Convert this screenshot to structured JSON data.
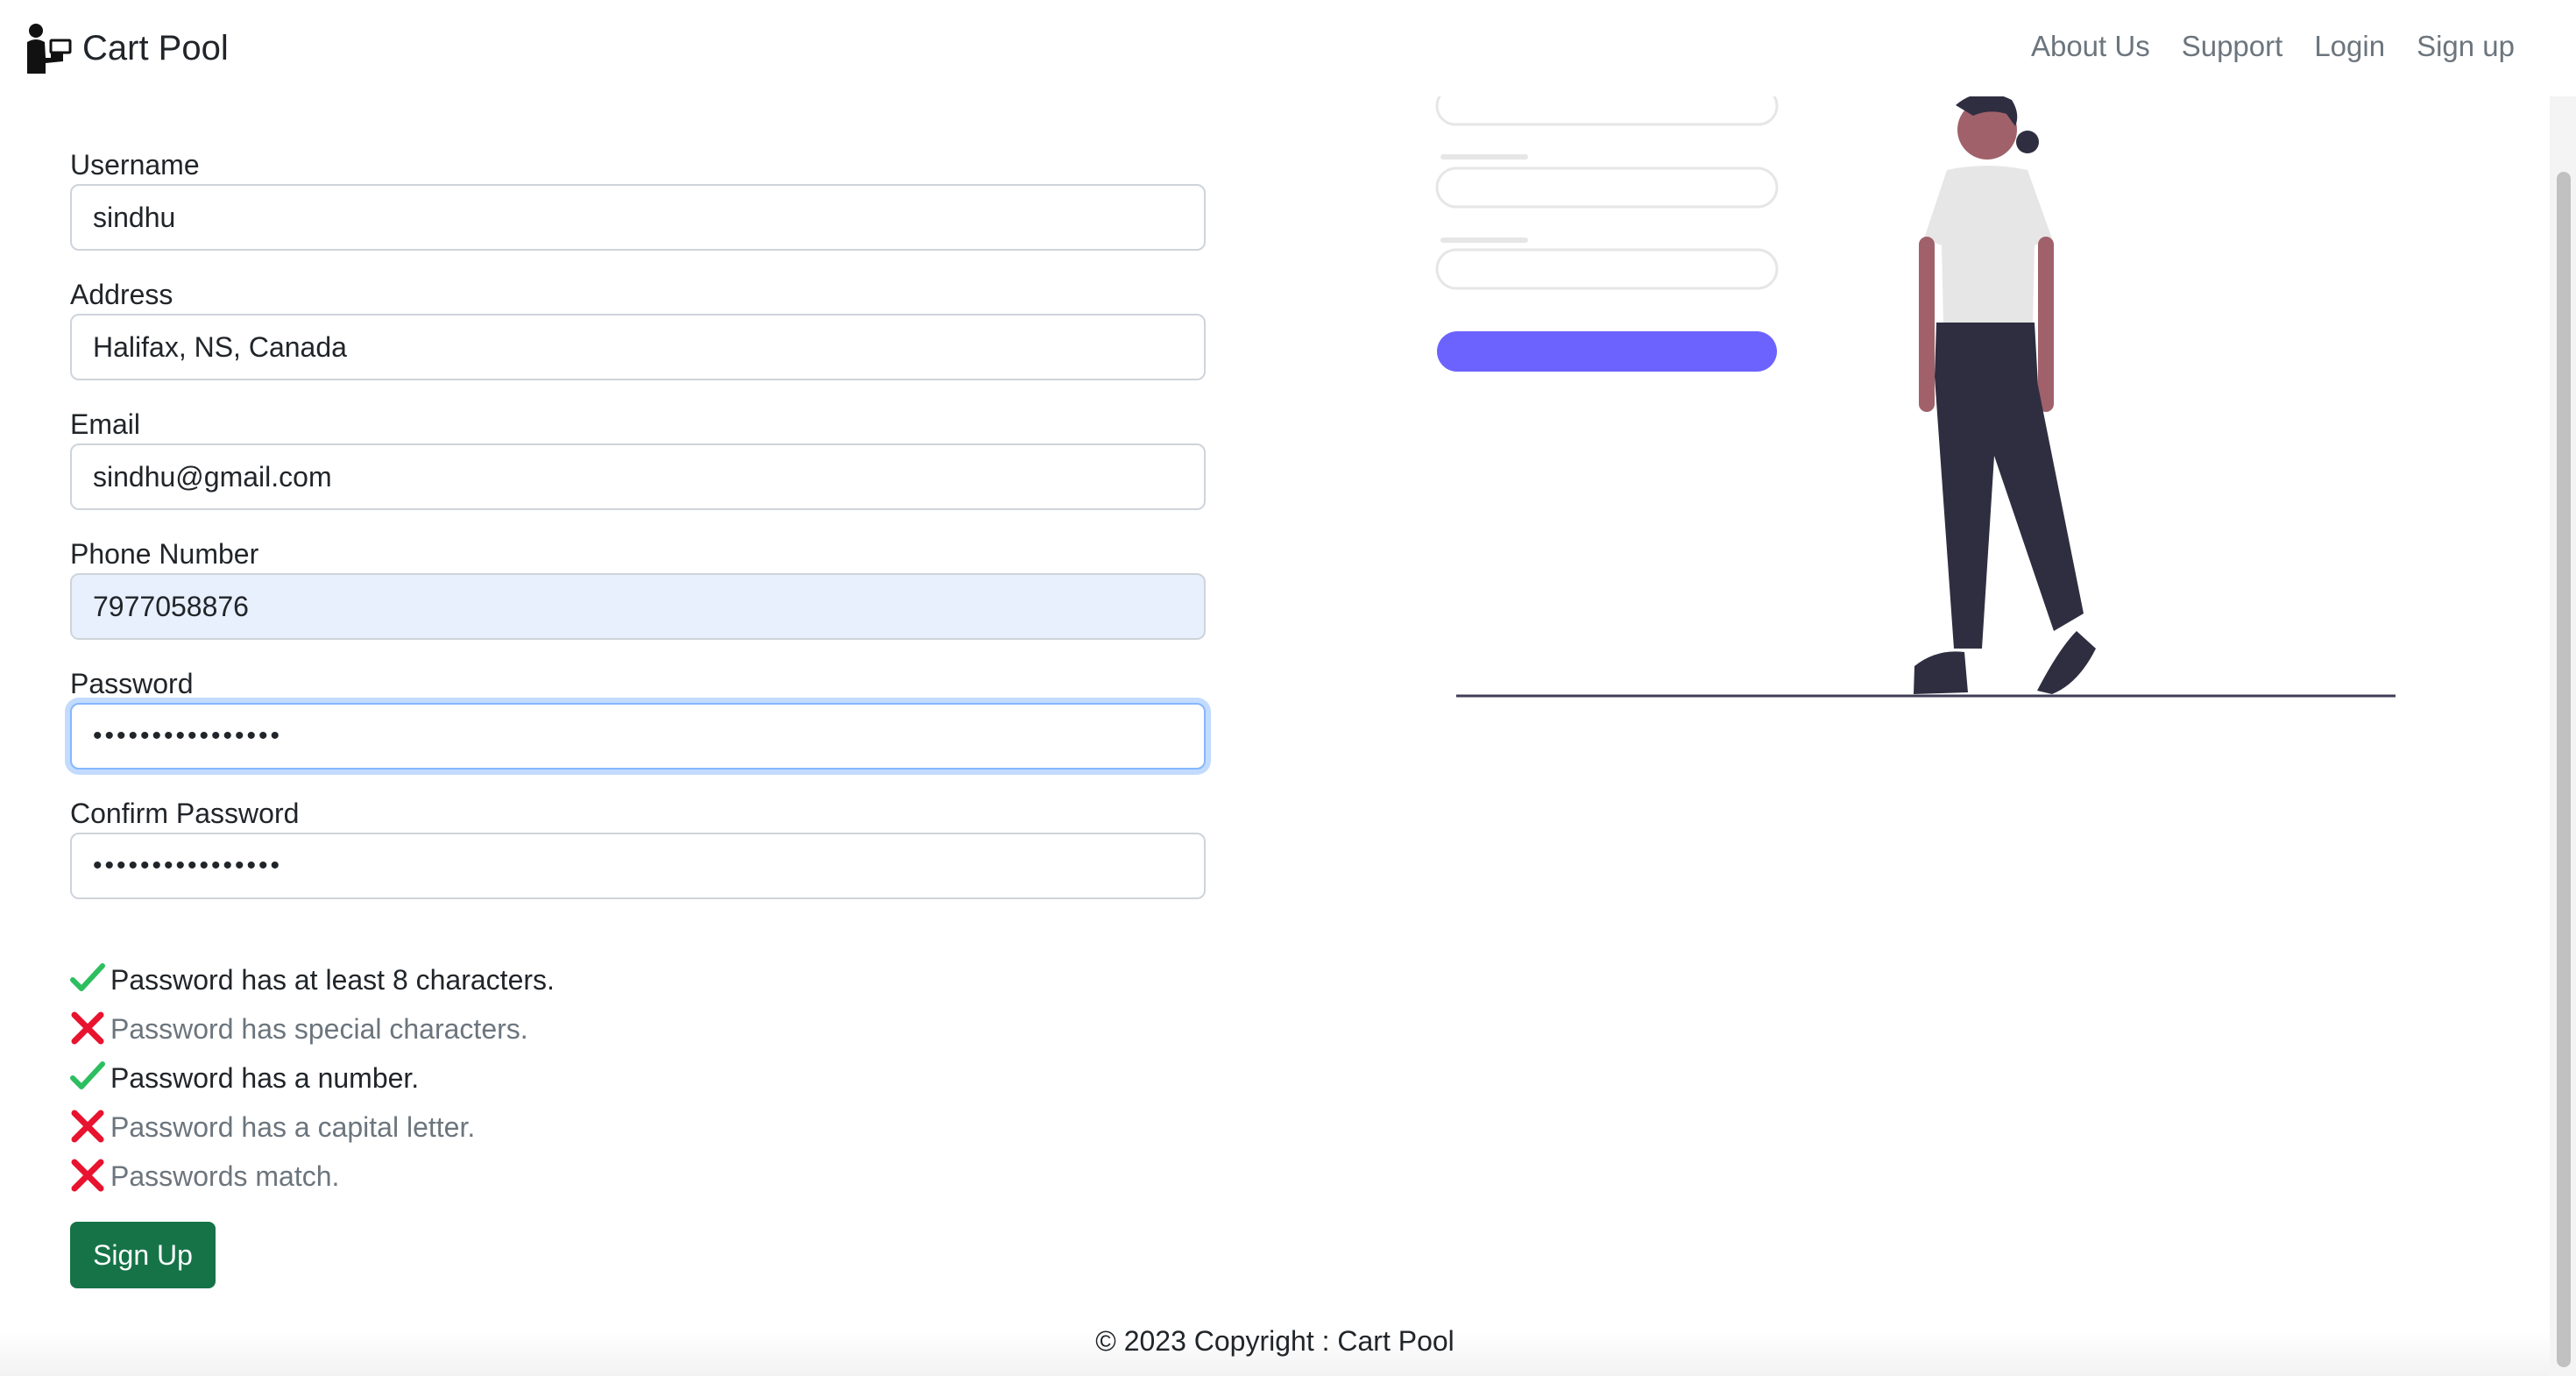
{
  "navbar": {
    "brand": "Cart Pool",
    "links": [
      "About Us",
      "Support",
      "Login",
      "Sign up"
    ]
  },
  "form": {
    "username": {
      "label": "Username",
      "value": "sindhu"
    },
    "address": {
      "label": "Address",
      "value": "Halifax, NS, Canada"
    },
    "email": {
      "label": "Email",
      "value": "sindhu@gmail.com"
    },
    "phone": {
      "label": "Phone Number",
      "value": "7977058876"
    },
    "password": {
      "label": "Password",
      "value": "••••••••••••••••"
    },
    "confirm": {
      "label": "Confirm Password",
      "value": "••••••••••••••••"
    }
  },
  "checks": [
    {
      "text": "Password has at least 8 characters.",
      "ok": true
    },
    {
      "text": "Password has special characters.",
      "ok": false
    },
    {
      "text": "Password has a number.",
      "ok": true
    },
    {
      "text": "Password has a capital letter.",
      "ok": false
    },
    {
      "text": "Passwords match.",
      "ok": false
    }
  ],
  "submit_label": "Sign Up",
  "footer": "© 2023 Copyright : Cart Pool",
  "colors": {
    "ok": "#2dbe60",
    "bad": "#e8132f",
    "primary": "#0d6efd",
    "success": "#157347",
    "illustration_accent": "#6c63ff"
  }
}
